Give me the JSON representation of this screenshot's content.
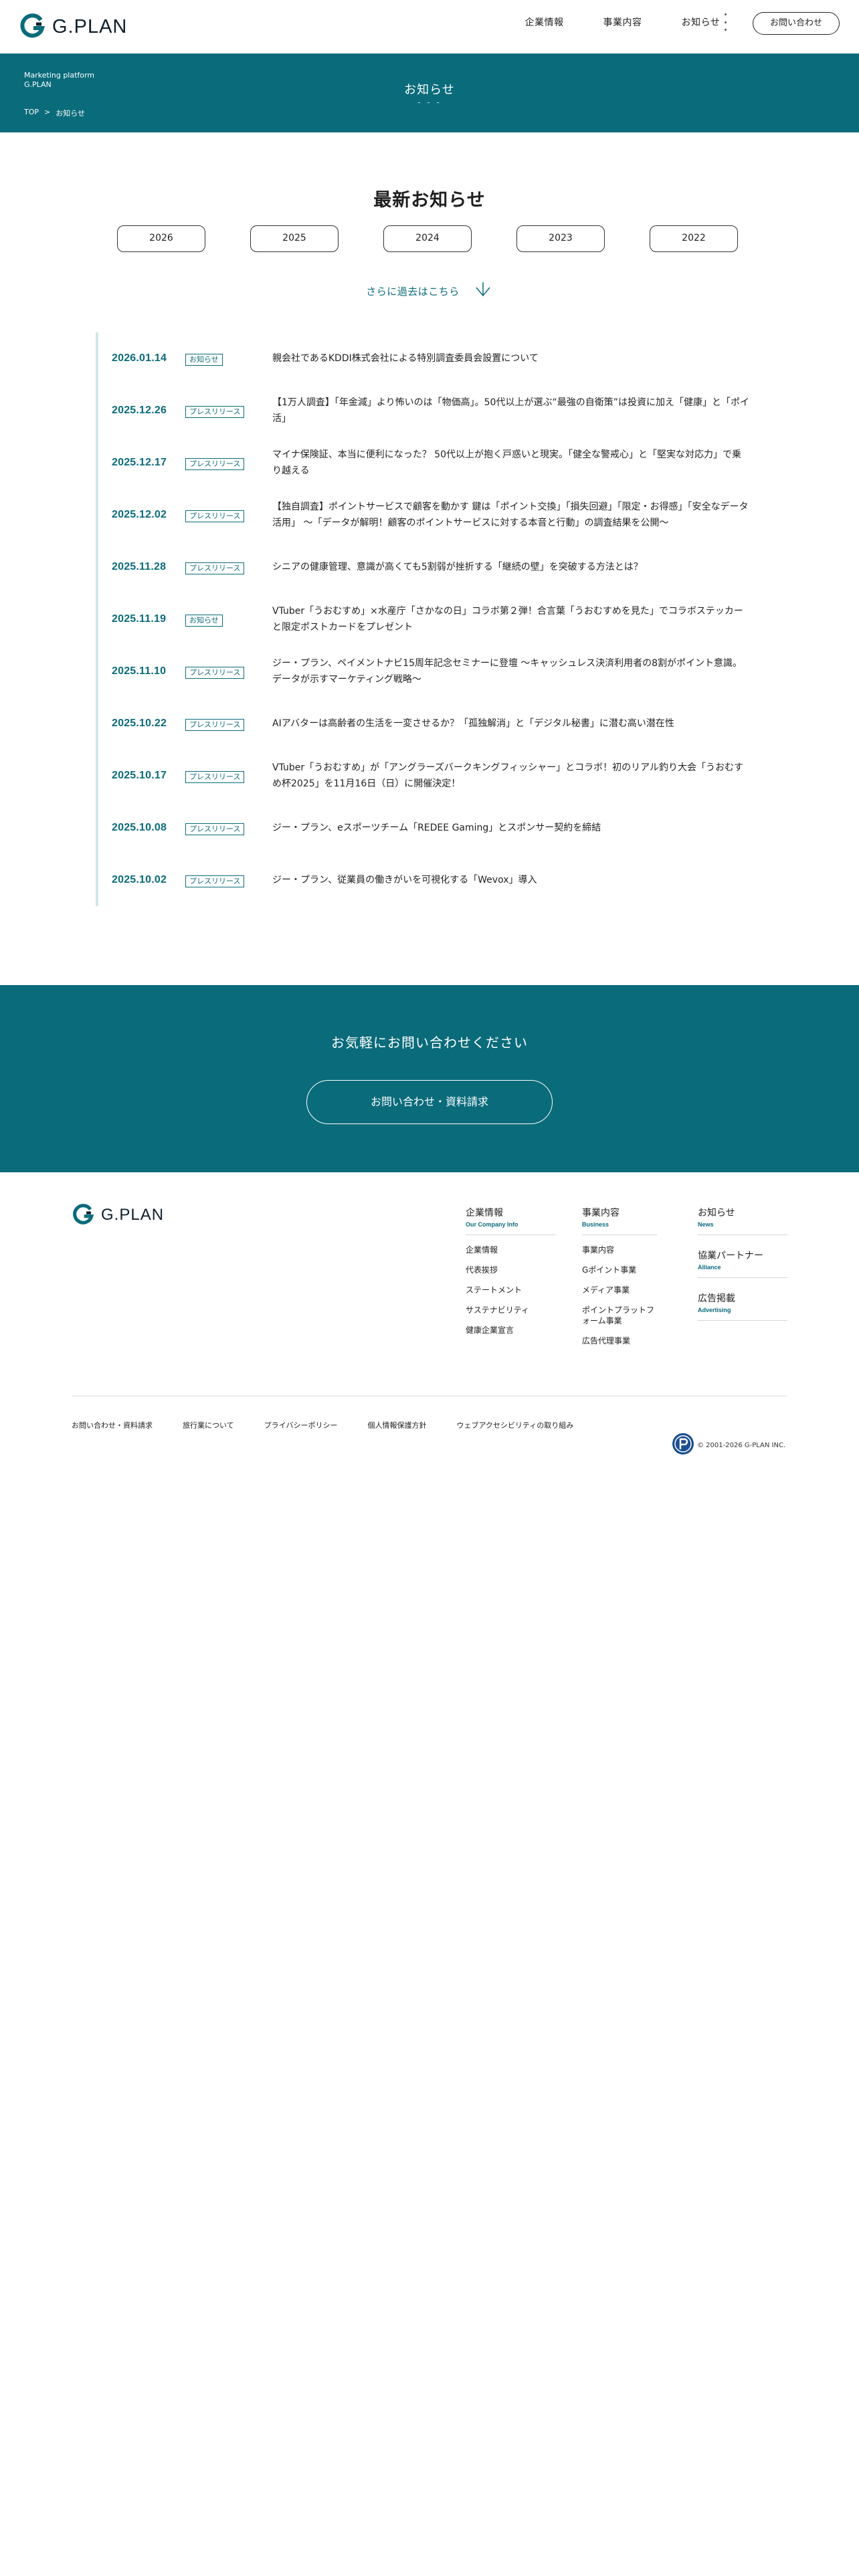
{
  "header": {
    "logo_text": "G.PLAN",
    "nav": [
      "企業情報",
      "事業内容",
      "お知らせ"
    ],
    "contact_button": "お問い合わせ"
  },
  "hero": {
    "brand_line1": "Marketing platform",
    "brand_line2": "G.PLAN",
    "title": "お知らせ",
    "dots": "- - -",
    "breadcrumb": {
      "home": "TOP",
      "separator": ">",
      "current": "お知らせ"
    }
  },
  "news_section": {
    "title": "最新お知らせ",
    "years": [
      "2026",
      "2025",
      "2024",
      "2023",
      "2022"
    ],
    "more_link": "さらに過去はこちら",
    "items": [
      {
        "date": "2026.01.14",
        "category": "お知らせ",
        "title": "親会社であるKDDI株式会社による特別調査委員会設置について"
      },
      {
        "date": "2025.12.26",
        "category": "プレスリリース",
        "title": "【1万人調査】「年金減」より怖いのは「物価高」。50代以上が選ぶ“最強の自衛策”は投資に加え「健康」と「ポイ活」"
      },
      {
        "date": "2025.12.17",
        "category": "プレスリリース",
        "title": "マイナ保険証、本当に便利になった？ 50代以上が抱く戸惑いと現実。「健全な警戒心」と「堅実な対応力」で乗り越える"
      },
      {
        "date": "2025.12.02",
        "category": "プレスリリース",
        "title": "【独自調査】ポイントサービスで顧客を動かす 鍵は「ポイント交換」「損失回避」「限定・お得感」「安全なデータ活用」 ～「データが解明！顧客のポイントサービスに対する本音と行動」の調査結果を公開～"
      },
      {
        "date": "2025.11.28",
        "category": "プレスリリース",
        "title": "シニアの健康管理、意識が高くても5割弱が挫折する「継続の壁」を突破する方法とは？"
      },
      {
        "date": "2025.11.19",
        "category": "お知らせ",
        "title": "VTuber「うおむすめ」×水産庁「さかなの日」コラボ第２弾！合言葉「うおむすめを見た」でコラボステッカーと限定ポストカードをプレゼント"
      },
      {
        "date": "2025.11.10",
        "category": "プレスリリース",
        "title": "ジー・プラン、ペイメントナビ15周年記念セミナーに登壇 〜キャッシュレス決済利用者の8割がポイント意識。データが示すマーケティング戦略〜"
      },
      {
        "date": "2025.10.22",
        "category": "プレスリリース",
        "title": "AIアバターは高齢者の生活を一変させるか？「孤独解消」と「デジタル秘書」に潜む高い潜在性"
      },
      {
        "date": "2025.10.17",
        "category": "プレスリリース",
        "title": "VTuber「うおむすめ」が「アングラーズバークキングフィッシャー」とコラボ！初のリアル釣り大会「うおむすめ杯2025」を11月16日（日）に開催決定！"
      },
      {
        "date": "2025.10.08",
        "category": "プレスリリース",
        "title": "ジー・プラン、eスポーツチーム「REDEE Gaming」とスポンサー契約を締結"
      },
      {
        "date": "2025.10.02",
        "category": "プレスリリース",
        "title": "ジー・プラン、従業員の働きがいを可視化する「Wevox」導入"
      }
    ]
  },
  "contact": {
    "title": "お気軽にお問い合わせください",
    "button": "お問い合わせ・資料請求"
  },
  "footer": {
    "logo_text": "G.PLAN",
    "columns": [
      {
        "blocks": [
          {
            "head": "企業情報",
            "en": "Our Company Info",
            "items": [
              "企業情報",
              "代表挨拶",
              "ステートメント",
              "サステナビリティ",
              "健康企業宣言"
            ]
          }
        ]
      },
      {
        "blocks": [
          {
            "head": "事業内容",
            "en": "Business",
            "items": [
              "事業内容",
              "Gポイント事業",
              "メディア事業",
              "ポイントプラットフォーム事業",
              "広告代理事業"
            ]
          }
        ]
      },
      {
        "blocks": [
          {
            "head": "お知らせ",
            "en": "News",
            "items": []
          },
          {
            "head": "協業パートナー",
            "en": "Alliance",
            "items": []
          },
          {
            "head": "広告掲載",
            "en": "Advertising",
            "items": []
          }
        ]
      }
    ],
    "bottom_links": [
      "お問い合わせ・資料請求",
      "旅行業について",
      "プライバシーポリシー",
      "個人情報保護方針",
      "ウェブアクセシビリティの取り組み"
    ],
    "copyright": "© 2001-2026 G-PLAN INC."
  },
  "colors": {
    "brand_teal": "#0a6b7b",
    "accent_line": "#d2e6e9"
  }
}
